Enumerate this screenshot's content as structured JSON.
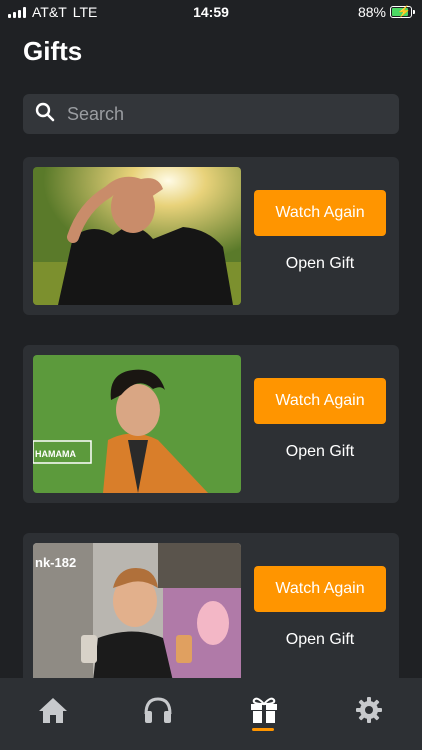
{
  "status": {
    "carrier": "AT&T",
    "network": "LTE",
    "time": "14:59",
    "battery": "88%"
  },
  "page": {
    "title": "Gifts"
  },
  "search": {
    "placeholder": "Search"
  },
  "gifts": [
    {
      "watch_label": "Watch Again",
      "open_label": "Open Gift"
    },
    {
      "watch_label": "Watch Again",
      "open_label": "Open Gift",
      "thumb_text": "HAMAMA"
    },
    {
      "watch_label": "Watch Again",
      "open_label": "Open Gift",
      "thumb_text": "nk-182"
    }
  ],
  "tabs": [
    {
      "name": "home",
      "icon": "home-icon"
    },
    {
      "name": "listen",
      "icon": "headphones-icon"
    },
    {
      "name": "gifts",
      "icon": "gift-icon",
      "active": true
    },
    {
      "name": "settings",
      "icon": "gear-icon"
    }
  ],
  "colors": {
    "accent": "#ff9500",
    "background": "#1f2124",
    "card": "#2d3034"
  }
}
